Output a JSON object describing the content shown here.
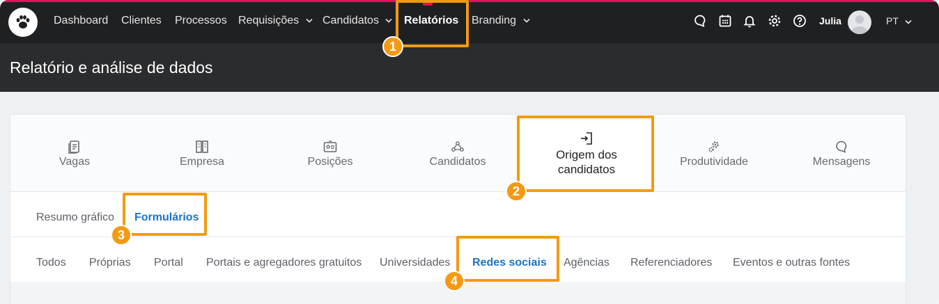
{
  "nav": {
    "items": [
      {
        "label": "Dashboard",
        "dropdown": false
      },
      {
        "label": "Clientes",
        "dropdown": false
      },
      {
        "label": "Processos",
        "dropdown": false
      },
      {
        "label": "Requisições",
        "dropdown": true
      },
      {
        "label": "Candidatos",
        "dropdown": true
      },
      {
        "label": "Relatórios",
        "dropdown": false,
        "active": true
      },
      {
        "label": "Branding",
        "dropdown": true
      }
    ],
    "user_name": "Julia",
    "language": "PT",
    "icons": [
      "chat-icon",
      "calendar-icon",
      "bell-icon",
      "gear-icon",
      "help-icon"
    ],
    "accent_color": "#e0135f"
  },
  "page": {
    "title": "Relatório e análise de dados"
  },
  "categories": [
    {
      "label": "Vagas",
      "icon": "document-list-icon"
    },
    {
      "label": "Empresa",
      "icon": "building-icon"
    },
    {
      "label": "Posições",
      "icon": "id-card-icon"
    },
    {
      "label": "Candidatos",
      "icon": "people-network-icon"
    },
    {
      "label": "Origem dos candidatos",
      "icon": "sign-in-icon",
      "active": true
    },
    {
      "label": "Produtividade",
      "icon": "gears-icon"
    },
    {
      "label": "Mensagens",
      "icon": "chat-bubble-icon"
    }
  ],
  "subtabs": [
    {
      "label": "Resumo gráfico"
    },
    {
      "label": "Formulários",
      "active": true
    }
  ],
  "sources": [
    {
      "label": "Todos"
    },
    {
      "label": "Próprias"
    },
    {
      "label": "Portal"
    },
    {
      "label": "Portais e agregadores gratuitos"
    },
    {
      "label": "Universidades"
    },
    {
      "label": "Redes sociais",
      "active": true
    },
    {
      "label": "Agências"
    },
    {
      "label": "Referenciadores"
    },
    {
      "label": "Eventos e outras fontes"
    }
  ],
  "annotations": {
    "color": "#f39a12",
    "badges": [
      "1",
      "2",
      "3",
      "4"
    ]
  },
  "colors": {
    "active_link": "#1a73c5",
    "topbar": "#1f2022",
    "header_band": "#2b2c2e"
  }
}
